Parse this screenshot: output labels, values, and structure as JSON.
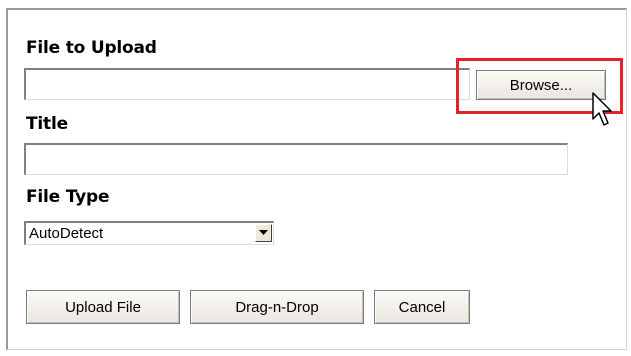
{
  "form": {
    "file_label": "File to Upload",
    "file_value": "",
    "browse_label": "Browse...",
    "title_label": "Title",
    "title_value": "",
    "filetype_label": "File Type",
    "filetype_selected": "AutoDetect"
  },
  "actions": {
    "upload_label": "Upload File",
    "dragdrop_label": "Drag-n-Drop",
    "cancel_label": "Cancel"
  },
  "icons": {
    "dropdown": "chevron-down-icon",
    "pointer": "mouse-pointer-icon"
  },
  "colors": {
    "highlight": "#e8202a",
    "button_face": "#ece9d8"
  }
}
